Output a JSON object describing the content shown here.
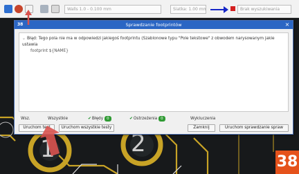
{
  "toolbar": {
    "combo1_text": "Walls 1.0 - 0.100 mm",
    "combo2_text": "Siatka: 1.00 mm",
    "combo3_text": "Brak wyszukiwania"
  },
  "dialog": {
    "title": "Sprawdzanie footprintów",
    "app_mark": "38",
    "close_glyph": "×",
    "message_line1": "Błąd: Tego pola nie ma w odpowiedzi jakiegoś footprintu (Szablonowe typu \"Pole tekstowe\" z obwodem narysowanym jakie ustawia",
    "message_line2": "footprint ${NAME}"
  },
  "filters": {
    "all_label": "Wsz.",
    "errors_label": "Wszystkie",
    "warnings_label": "Błędy",
    "warnings_count": "0",
    "ignored_label": "Ostrzeżenia",
    "ignored_count": "0",
    "excluded_label": "Wykluczenia"
  },
  "buttons": {
    "run_label": "Uruchom test",
    "run_all_label": "Uruchom wszystkie testy",
    "close_label": "Zamknij",
    "run_selected_label": "Uruchom sprawdzanie spraw"
  },
  "pcb_pads": {
    "pad_left_label": "1",
    "pad_right_label": "2"
  },
  "step_number": "38",
  "colors": {
    "title_bar": "#2b66c4",
    "check_green": "#2f9a33",
    "annotation_red": "#d9534f",
    "annotation_blue": "#1626c8",
    "step_badge": "#e5521b",
    "pad_yellow": "#c8a326"
  }
}
